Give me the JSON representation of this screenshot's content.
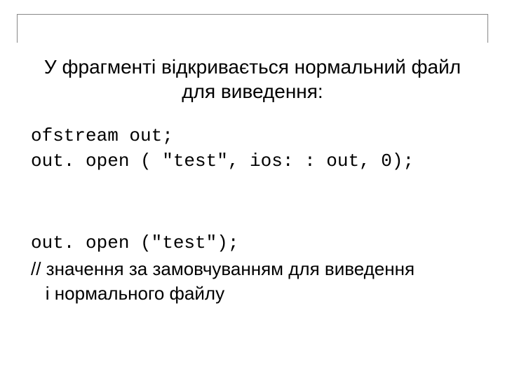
{
  "title_line1": "У фрагменті відкривається нормальний файл",
  "title_line2": "для виведення:",
  "code1_line1": "ofstream out;",
  "code1_line2": "out. open ( \"test\", ios: : out, 0);",
  "code2_line1": "out. open (\"test\");",
  "comment_line1": "// значення за замовчуванням для виведення",
  "comment_line2": "і нормального файлу"
}
